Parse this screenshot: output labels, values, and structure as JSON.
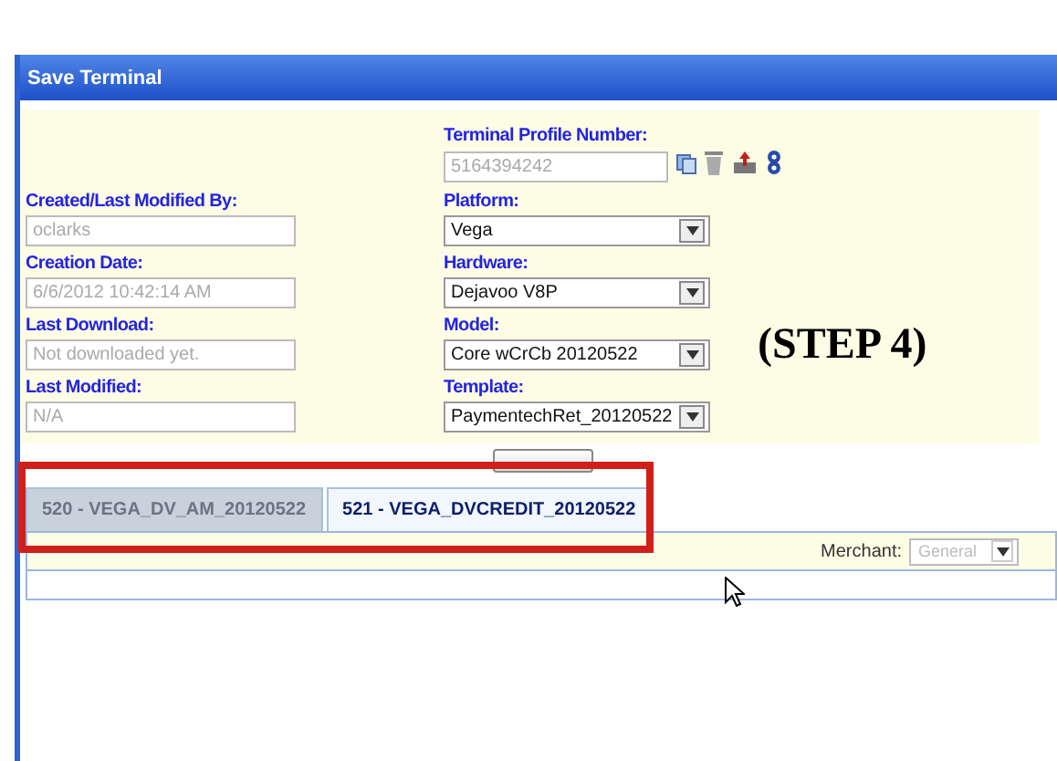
{
  "window": {
    "title": "Save Terminal"
  },
  "terminal_profile": {
    "label": "Terminal Profile Number:",
    "value": "5164394242"
  },
  "left_fields": [
    {
      "label": "Created/Last Modified By:",
      "value": "oclarks"
    },
    {
      "label": "Creation Date:",
      "value": "6/6/2012 10:42:14 AM"
    },
    {
      "label": "Last Download:",
      "value": "Not downloaded yet."
    },
    {
      "label": "Last Modified:",
      "value": "N/A"
    }
  ],
  "right_fields": [
    {
      "label": "Platform:",
      "value": "Vega"
    },
    {
      "label": "Hardware:",
      "value": "Dejavoo V8P"
    },
    {
      "label": "Model:",
      "value": "Core wCrCb 20120522"
    },
    {
      "label": "Template:",
      "value": "PaymentechRet_20120522"
    }
  ],
  "tabs": [
    {
      "label": "520 - VEGA_DV_AM_20120522",
      "selected": false
    },
    {
      "label": "521 - VEGA_DVCREDIT_20120522",
      "selected": true
    }
  ],
  "merchant": {
    "label": "Merchant:",
    "value": "General",
    "disabled": true
  },
  "annotation": "(STEP 4)"
}
